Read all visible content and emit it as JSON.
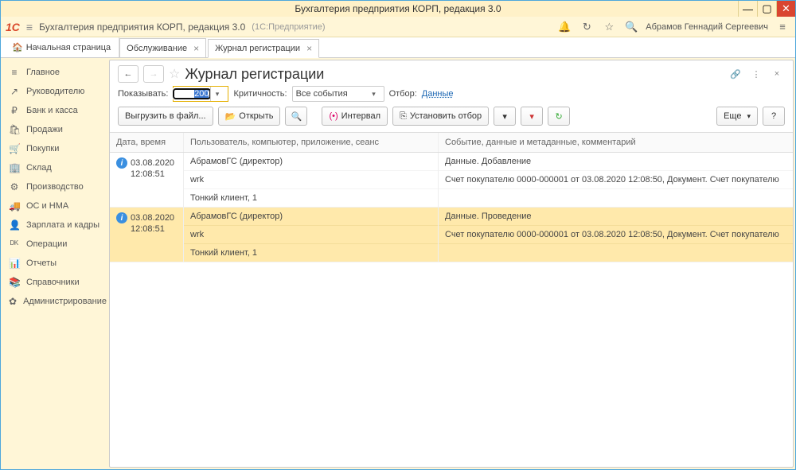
{
  "window": {
    "title": "Бухгалтерия предприятия КОРП, редакция 3.0"
  },
  "topbar": {
    "app_title": "Бухгалтерия предприятия КОРП, редакция 3.0",
    "sub": "(1С:Предприятие)",
    "user": "Абрамов Геннадий Сергеевич"
  },
  "tabs": {
    "home": "Начальная страница",
    "list": [
      {
        "label": "Обслуживание"
      },
      {
        "label": "Журнал регистрации"
      }
    ]
  },
  "sidebar": [
    {
      "icon": "≡",
      "label": "Главное"
    },
    {
      "icon": "↗",
      "label": "Руководителю"
    },
    {
      "icon": "₽",
      "label": "Банк и касса"
    },
    {
      "icon": "🛍",
      "label": "Продажи"
    },
    {
      "icon": "🛒",
      "label": "Покупки"
    },
    {
      "icon": "🏢",
      "label": "Склад"
    },
    {
      "icon": "⚙",
      "label": "Производство"
    },
    {
      "icon": "🚚",
      "label": "ОС и НМА"
    },
    {
      "icon": "👤",
      "label": "Зарплата и кадры"
    },
    {
      "icon": "ᴰᴷ",
      "label": "Операции"
    },
    {
      "icon": "📊",
      "label": "Отчеты"
    },
    {
      "icon": "📚",
      "label": "Справочники"
    },
    {
      "icon": "✿",
      "label": "Администрирование"
    }
  ],
  "page": {
    "title": "Журнал регистрации"
  },
  "filter": {
    "show_label": "Показывать:",
    "show_value": "200",
    "crit_label": "Критичность:",
    "crit_value": "Все события",
    "otbor_label": "Отбор:",
    "otbor_link": "Данные"
  },
  "buttons": {
    "export": "Выгрузить в файл...",
    "open": "Открыть",
    "interval": "Интервал",
    "set_filter": "Установить отбор",
    "more": "Еще"
  },
  "columns": {
    "c1": "Дата, время",
    "c2": "Пользователь, компьютер, приложение, сеанс",
    "c3": "Событие, данные и метаданные, комментарий"
  },
  "entries": [
    {
      "date": "03.08.2020",
      "time": "12:08:51",
      "u1": "АбрамовГС (директор)",
      "u2": "wrk",
      "u3": "Тонкий клиент, 1",
      "e1": "Данные. Добавление",
      "e2": "Счет покупателю 0000-000001 от 03.08.2020 12:08:50, Документ. Счет покупателю",
      "selected": false
    },
    {
      "date": "03.08.2020",
      "time": "12:08:51",
      "u1": "АбрамовГС (директор)",
      "u2": "wrk",
      "u3": "Тонкий клиент, 1",
      "e1": "Данные. Проведение",
      "e2": "Счет покупателю 0000-000001 от 03.08.2020 12:08:50, Документ. Счет покупателю",
      "selected": true
    }
  ]
}
